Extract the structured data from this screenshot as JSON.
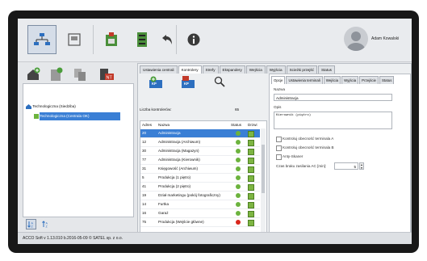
{
  "user": {
    "name": "Adam Kowalski"
  },
  "toolbar": {
    "buttons": [
      "structure-icon",
      "device-icon",
      "panel-icon",
      "cabinet-icon",
      "undo-icon",
      "info-icon"
    ]
  },
  "tree": {
    "root": "Technologiczna (Siedziba)",
    "child": "Technologiczna (Centrala OK)"
  },
  "tabs": [
    "Ustawienia centrali",
    "Kontrolery",
    "Strefy",
    "Ekspandery",
    "Wejścia",
    "Wyjścia",
    "Scieżki przejść",
    "Status"
  ],
  "kp": {
    "label_kp": "KP",
    "count_label": "Liczba kontrolerów:",
    "count_value": "65"
  },
  "table": {
    "headers": {
      "adres": "Adres",
      "nazwa": "Nazwa",
      "status": "Status",
      "drzwi": "Drzwi"
    },
    "rows": [
      {
        "adres": "20",
        "nazwa": "Administracja",
        "status": "ok"
      },
      {
        "adres": "12",
        "nazwa": "Administracja (Archiwum)",
        "status": "ok"
      },
      {
        "adres": "30",
        "nazwa": "Administracja (Magazyn)",
        "status": "ok"
      },
      {
        "adres": "77",
        "nazwa": "Administracja (Kierownik)",
        "status": "ok"
      },
      {
        "adres": "31",
        "nazwa": "Księgowość (Archiwum)",
        "status": "ok"
      },
      {
        "adres": "5",
        "nazwa": "Produkcja (1 piętro)",
        "status": "ok"
      },
      {
        "adres": "41",
        "nazwa": "Produkcja (2 piętro)",
        "status": "ok"
      },
      {
        "adres": "19",
        "nazwa": "Dział marketingu (pokój fotograficzny)",
        "status": "ok"
      },
      {
        "adres": "14",
        "nazwa": "Furtka",
        "status": "ok"
      },
      {
        "adres": "16",
        "nazwa": "Garaż",
        "status": "ok"
      },
      {
        "adres": "75",
        "nazwa": "Produkcja (Wejście główne)",
        "status": "error"
      }
    ]
  },
  "detail": {
    "tabs": [
      "Opcje",
      "Ustawienia terminali",
      "Wejścia",
      "Wyjścia",
      "Przejście",
      "Status"
    ],
    "name_label": "Nazwa",
    "name_value": "Administracja",
    "desc_label": "Opis",
    "desc_value": "Kierownik (piętro)",
    "checks": [
      "Kontroluj obecność terminala A",
      "Kontroluj obecność terminala B",
      "Anty-Skaner"
    ],
    "time_label": "Czas braku zasilania AC [min]:",
    "time_value": "5"
  },
  "statusbar": {
    "text": "ACCO Soft v 1.13.010 b.2016-05-09   © SATEL sp. z o.o."
  },
  "colors": {
    "accent": "#3a7fd5",
    "ok": "#6cb33e",
    "error": "#d9261c"
  }
}
